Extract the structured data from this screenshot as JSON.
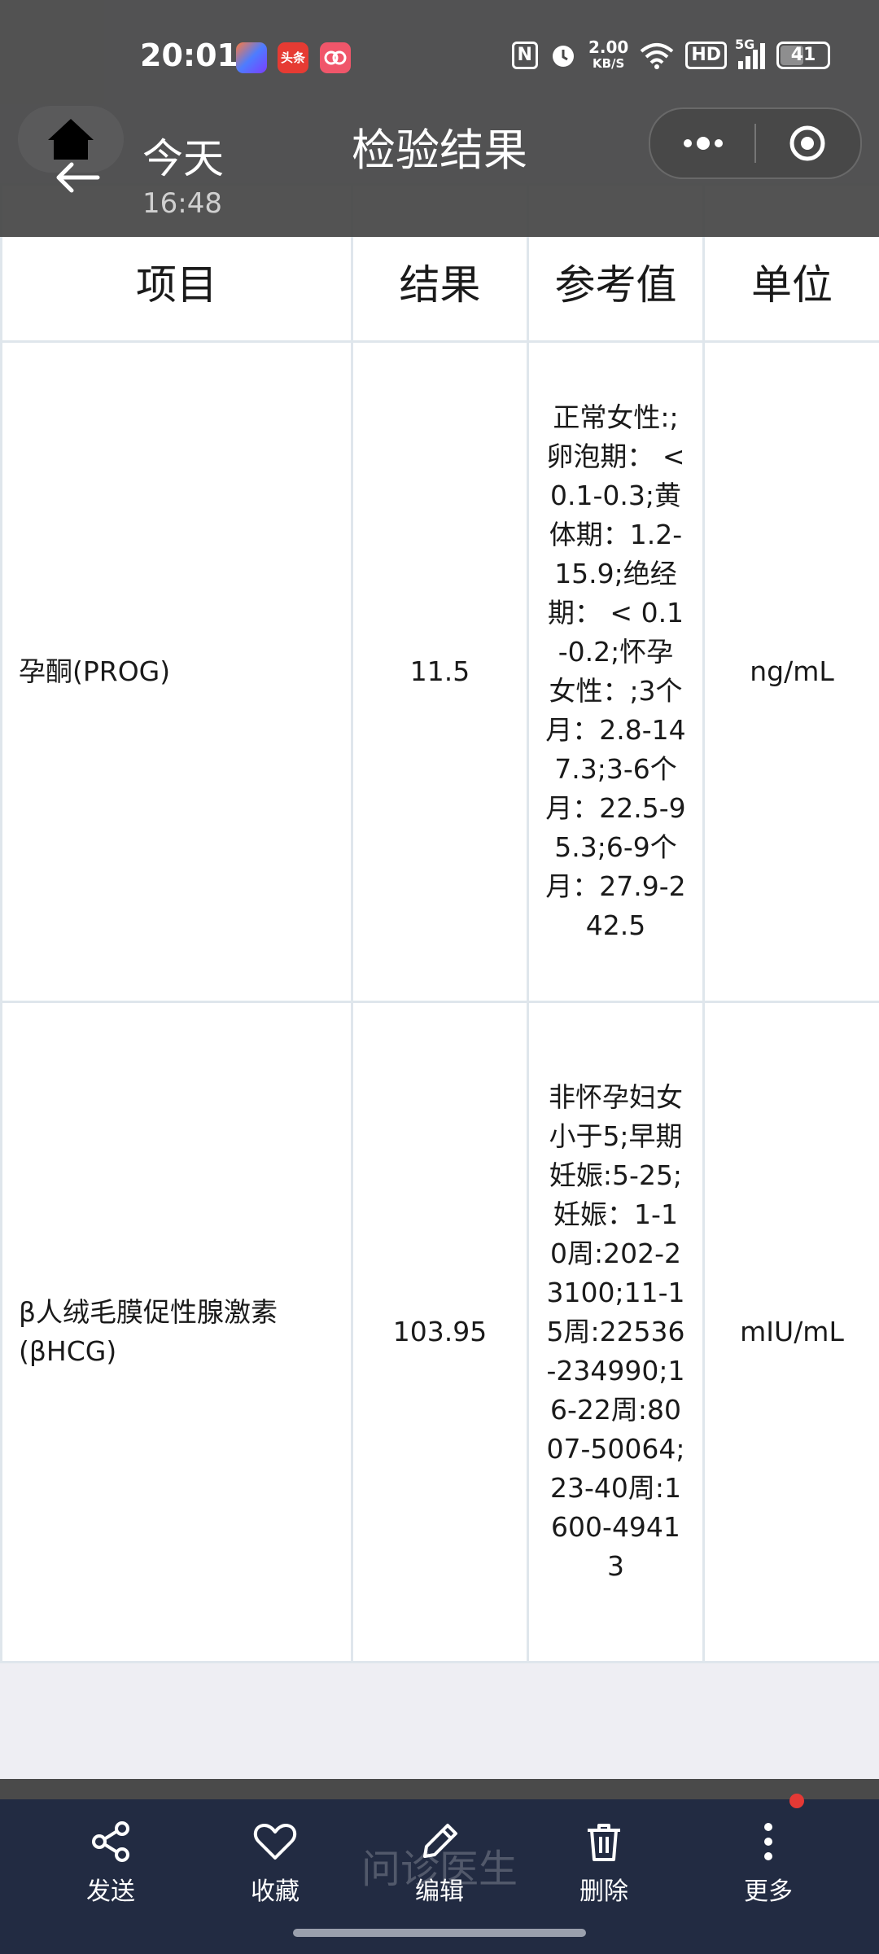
{
  "status_bar": {
    "time": "20:01",
    "app_icons": [
      "assistant-app-icon",
      "toutiao-app-icon",
      "cloud-app-icon"
    ],
    "app_badge_toutiao": "头条",
    "nfc": "N",
    "net_speed_value": "2.00",
    "net_speed_unit": "KB/S",
    "hd": "HD",
    "signal_label": "5G",
    "battery": "41"
  },
  "nav": {
    "title": "检验结果",
    "chat_name": "今天",
    "chat_time": "16:48"
  },
  "table": {
    "headers": [
      "项目",
      "结果",
      "参考值",
      "单位"
    ],
    "rows": [
      {
        "item": "孕酮(PROG)",
        "result": "11.5",
        "reference": "正常女性:;卵泡期：  < 0.1-0.3;黄体期：1.2-15.9;绝经期：  < 0.1-0.2;怀孕女性：;3个月：2.8-147.3;3-6个月：22.5-95.3;6-9个月：27.9-242.5",
        "unit": "ng/mL"
      },
      {
        "item": "β人绒毛膜促性腺激素(βHCG)",
        "result": "103.95",
        "reference": "非怀孕妇女小于5;早期妊娠:5-25;妊娠：1-10周:202-23100;11-15周:22536-234990;16-22周:8007-50064;23-40周:1600-49413",
        "unit": "mIU/mL"
      }
    ]
  },
  "bottom_bar": {
    "actions": [
      "发送",
      "收藏",
      "编辑",
      "删除",
      "更多"
    ],
    "ghost_text": "问诊医生"
  },
  "colors": {
    "overlay": "#464646",
    "bottom_bar": "#222b42",
    "table_border": "#dfe6ec",
    "badge_red": "#e53935"
  }
}
